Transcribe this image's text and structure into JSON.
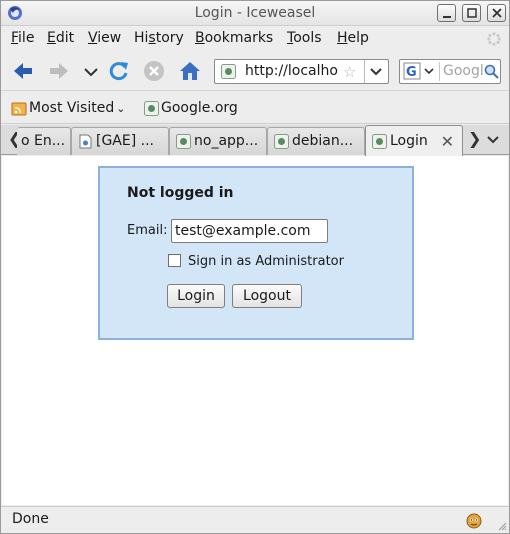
{
  "window": {
    "title": "Login - Iceweasel"
  },
  "menu": {
    "items": [
      {
        "label": "File",
        "u": "F",
        "rest": "ile"
      },
      {
        "label": "Edit",
        "u": "E",
        "rest": "dit"
      },
      {
        "label": "View",
        "u": "V",
        "rest": "iew"
      },
      {
        "label": "History",
        "u": "",
        "pre": "Hi",
        "u2": "s",
        "rest": "tory"
      },
      {
        "label": "Bookmarks",
        "u": "B",
        "rest": "ookmarks"
      },
      {
        "label": "Tools",
        "u": "T",
        "rest": "ools"
      },
      {
        "label": "Help",
        "u": "H",
        "rest": "elp"
      }
    ]
  },
  "nav": {
    "url": "http://localho",
    "search_placeholder": "Google",
    "icons": [
      "back-icon",
      "forward-icon",
      "history-dropdown-icon",
      "reload-icon",
      "stop-icon",
      "home-icon"
    ]
  },
  "bookmarks": {
    "most_visited": "Most Visited",
    "google_org": "Google.org"
  },
  "tabs": [
    {
      "label": "En..."
    },
    {
      "label": "[GAE] ..."
    },
    {
      "label": "no_app..."
    },
    {
      "label": "debian..."
    },
    {
      "label": "Login"
    }
  ],
  "login": {
    "title": "Not logged in",
    "email_label": "Email:",
    "email_value": "test@example.com",
    "admin_label": "Sign in as Administrator",
    "admin_checked": false,
    "login_button": "Login",
    "logout_button": "Logout"
  },
  "status": {
    "text": "Done"
  },
  "colors": {
    "login_box_bg": "#d2e6f8",
    "login_box_border": "#8cb2d9",
    "nav_arrow": "#2a5db0"
  }
}
